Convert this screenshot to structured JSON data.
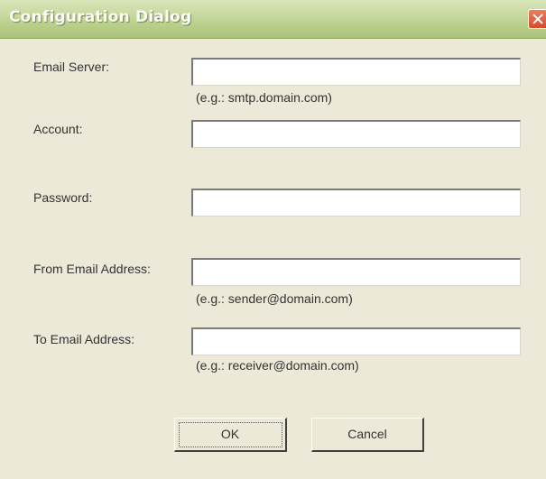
{
  "window": {
    "title": "Configuration Dialog",
    "close_icon": "close-icon"
  },
  "form": {
    "email_server": {
      "label": "Email Server:",
      "value": "",
      "hint": "(e.g.: smtp.domain.com)"
    },
    "account": {
      "label": "Account:",
      "value": ""
    },
    "password": {
      "label": "Password:",
      "value": ""
    },
    "from_email": {
      "label": "From Email Address:",
      "value": "",
      "hint": "(e.g.: sender@domain.com)"
    },
    "to_email": {
      "label": "To Email Address:",
      "value": "",
      "hint": "(e.g.: receiver@domain.com)"
    }
  },
  "buttons": {
    "ok": "OK",
    "cancel": "Cancel"
  },
  "colors": {
    "title_bar": "#c4d79b",
    "dialog_bg": "#ece9d8",
    "close_button": "#d9482a"
  }
}
